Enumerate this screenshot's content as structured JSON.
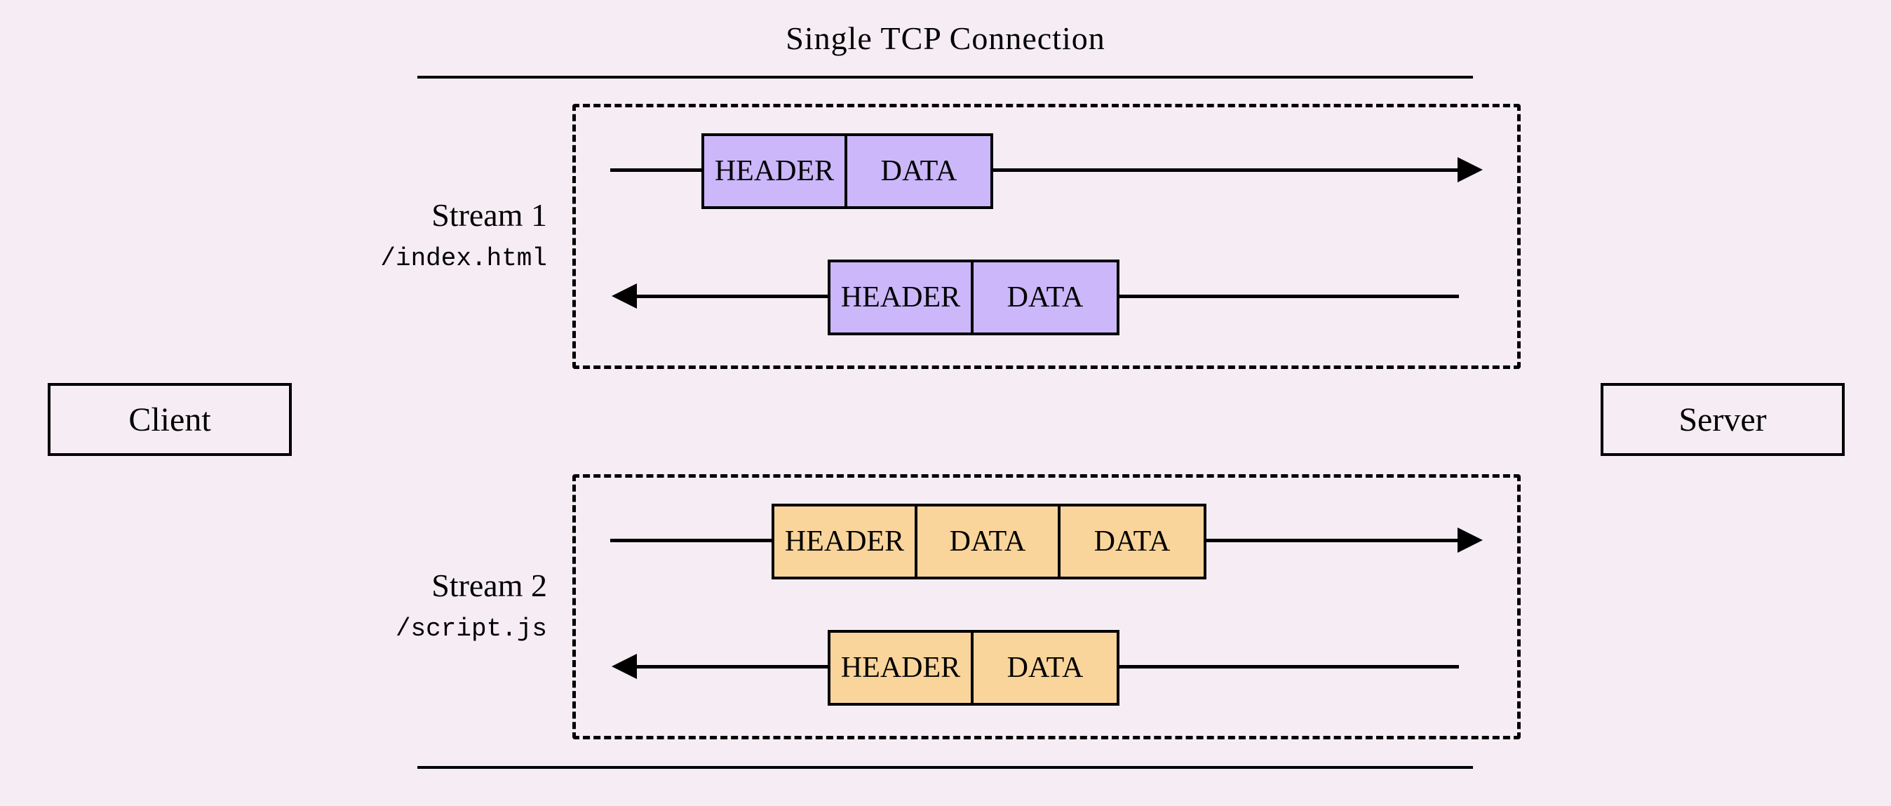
{
  "title": "Single TCP Connection",
  "nodes": {
    "client": "Client",
    "server": "Server"
  },
  "streams": [
    {
      "name": "Stream 1",
      "resource": "/index.html",
      "color_key": "purple",
      "request_frames": [
        "HEADER",
        "DATA"
      ],
      "response_frames": [
        "HEADER",
        "DATA"
      ]
    },
    {
      "name": "Stream 2",
      "resource": "/script.js",
      "color_key": "orange",
      "request_frames": [
        "HEADER",
        "DATA",
        "DATA"
      ],
      "response_frames": [
        "HEADER",
        "DATA"
      ]
    }
  ],
  "frame_labels": {
    "header": "HEADER",
    "data": "DATA"
  },
  "colors": {
    "purple": "#cbb7f9",
    "orange": "#fad59b",
    "background": "#f5edf3"
  }
}
